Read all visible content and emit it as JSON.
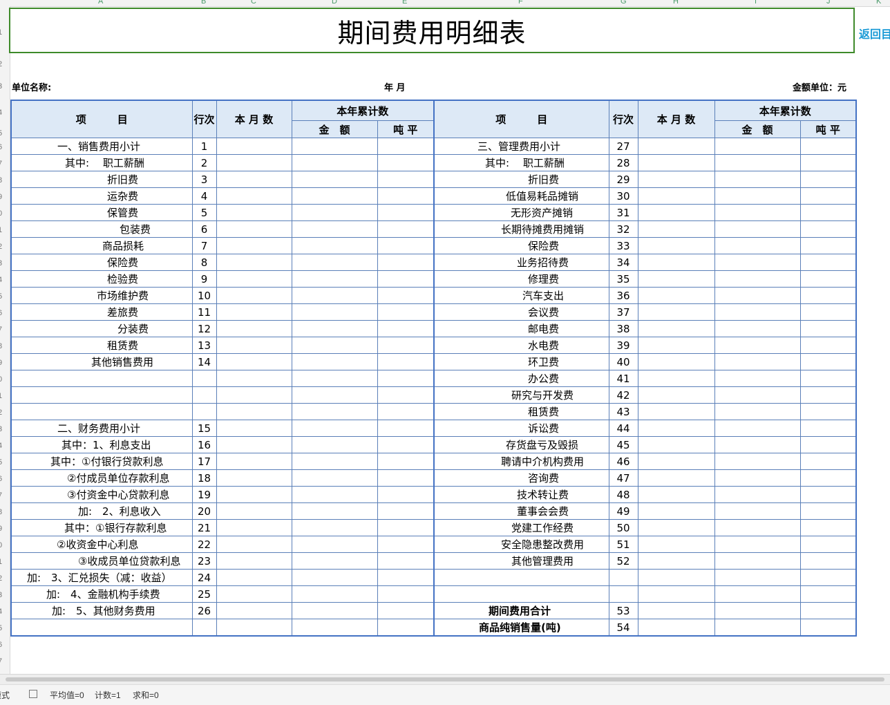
{
  "columns": [
    "A",
    "B",
    "C",
    "D",
    "E",
    "F",
    "G",
    "H",
    "I",
    "J",
    "K"
  ],
  "row_numbers": [
    "1",
    "2",
    "3",
    "4",
    "5",
    "6",
    "7",
    "8",
    "9",
    "0",
    "1",
    "2",
    "3",
    "4",
    "5",
    "6",
    "7",
    "8",
    "9",
    "0",
    "1",
    "2",
    "3",
    "4",
    "5",
    "6",
    "7",
    "8",
    "9",
    "0",
    "1",
    "2",
    "3",
    "4",
    "5",
    "6",
    "7"
  ],
  "title": "期间费用明细表",
  "return_link": "返回目",
  "unit_name_label": "单位名称:",
  "period_label": "年  月",
  "amount_unit_label": "金额单位：元",
  "header": {
    "item": "项　　　目",
    "line_no": "行次",
    "month": "本 月 数",
    "ytd": "本年累计数",
    "amount": "金　额",
    "per_ton": "吨 平"
  },
  "rows": [
    {
      "l": "一、销售费用小计",
      "ln": "1",
      "r": "三、管理费用小计",
      "rn": "27"
    },
    {
      "l": "其中:　 职工薪酬",
      "ln": "2",
      "r": "其中:　 职工薪酬",
      "rn": "28"
    },
    {
      "l": "折旧费",
      "ln": "3",
      "r": "折旧费",
      "rn": "29"
    },
    {
      "l": "运杂费",
      "ln": "4",
      "r": "低值易耗品摊销",
      "rn": "30"
    },
    {
      "l": "保管费",
      "ln": "5",
      "r": "无形资产摊销",
      "rn": "31"
    },
    {
      "l": "包装费",
      "ln": "6",
      "r": "长期待摊费用摊销",
      "rn": "32"
    },
    {
      "l": "商品损耗",
      "ln": "7",
      "r": "保险费",
      "rn": "33"
    },
    {
      "l": "保险费",
      "ln": "8",
      "r": "业务招待费",
      "rn": "34"
    },
    {
      "l": "检验费",
      "ln": "9",
      "r": "修理费",
      "rn": "35"
    },
    {
      "l": "市场维护费",
      "ln": "10",
      "r": "汽车支出",
      "rn": "36"
    },
    {
      "l": "差旅费",
      "ln": "11",
      "r": "会议费",
      "rn": "37"
    },
    {
      "l": "分装费",
      "ln": "12",
      "r": "邮电费",
      "rn": "38"
    },
    {
      "l": "租赁费",
      "ln": "13",
      "r": "水电费",
      "rn": "39"
    },
    {
      "l": "其他销售费用",
      "ln": "14",
      "r": "环卫费",
      "rn": "40"
    },
    {
      "l": "",
      "ln": "",
      "r": "办公费",
      "rn": "41"
    },
    {
      "l": "",
      "ln": "",
      "r": "研究与开发费",
      "rn": "42"
    },
    {
      "l": "",
      "ln": "",
      "r": "租赁费",
      "rn": "43"
    },
    {
      "l": "二、财务费用小计",
      "ln": "15",
      "r": "诉讼费",
      "rn": "44"
    },
    {
      "l": "其中：1、利息支出",
      "ln": "16",
      "r": "存货盘亏及毁损",
      "rn": "45"
    },
    {
      "l": "其中：①付银行贷款利息",
      "ln": "17",
      "r": "聘请中介机构费用",
      "rn": "46"
    },
    {
      "l": "②付成员单位存款利息",
      "ln": "18",
      "r": "咨询费",
      "rn": "47"
    },
    {
      "l": "③付资金中心贷款利息",
      "ln": "19",
      "r": "技术转让费",
      "rn": "48"
    },
    {
      "l": "加:　2、利息收入",
      "ln": "20",
      "r": "董事会会费",
      "rn": "49"
    },
    {
      "l": "其中：①银行存款利息",
      "ln": "21",
      "r": "党建工作经费",
      "rn": "50"
    },
    {
      "l": "②收资金中心利息",
      "ln": "22",
      "r": "安全隐患整改费用",
      "rn": "51"
    },
    {
      "l": "③收成员单位贷款利息",
      "ln": "23",
      "r": "其他管理费用",
      "rn": "52"
    },
    {
      "l": "加:　3、汇兑损失（减：收益）",
      "ln": "24",
      "r": "",
      "rn": ""
    },
    {
      "l": "加:　4、金融机构手续费",
      "ln": "25",
      "r": "",
      "rn": ""
    },
    {
      "l": "加:　5、其他财务费用",
      "ln": "26",
      "r": "期间费用合计",
      "rn": "53"
    },
    {
      "l": "",
      "ln": "",
      "r": "商品纯销售量(吨)",
      "rn": "54"
    }
  ],
  "status_bar": {
    "left": "模式",
    "average": "平均值=0",
    "count": "计数=1",
    "sum": "求和=0"
  }
}
